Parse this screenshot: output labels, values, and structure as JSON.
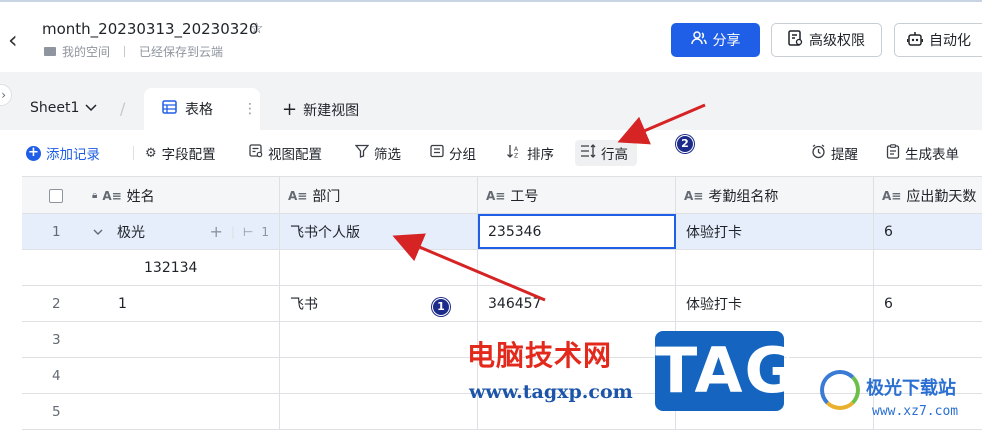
{
  "header": {
    "title": "month_20230313_20230320",
    "space": "我的空间",
    "save_status": "已经保存到云端",
    "share_label": "分享",
    "permission_label": "高级权限",
    "automation_label": "自动化"
  },
  "tabs": {
    "sheet_name": "Sheet1",
    "active_view": "表格",
    "new_view": "新建视图"
  },
  "toolbar": {
    "add_record": "添加记录",
    "field_config": "字段配置",
    "view_config": "视图配置",
    "filter": "筛选",
    "group": "分组",
    "sort": "排序",
    "row_height": "行高",
    "reminder": "提醒",
    "form": "生成表单"
  },
  "columns": [
    "姓名",
    "部门",
    "工号",
    "考勤组名称",
    "应出勤天数"
  ],
  "rows": [
    {
      "num": "1",
      "name": "极光",
      "dept": "飞书个人版",
      "id": "235346",
      "group": "体验打卡",
      "days": "6",
      "sub": "132134",
      "child_count": "1"
    },
    {
      "num": "2",
      "name": "1",
      "dept": "飞书",
      "id": "346457",
      "group": "体验打卡",
      "days": "6"
    },
    {
      "num": "3"
    },
    {
      "num": "4"
    },
    {
      "num": "5"
    }
  ],
  "watermark": {
    "cn": "电脑技术网",
    "url": "www.tagxp.com",
    "tag": "TAG",
    "site": "极光下载站",
    "site_url": "www.xz7.com"
  },
  "annotations": {
    "badge1": "1",
    "badge2": "2"
  },
  "colors": {
    "accent": "#1f5ee6",
    "selected_row": "#e6edfb",
    "annotation_arrow": "#d62424"
  }
}
